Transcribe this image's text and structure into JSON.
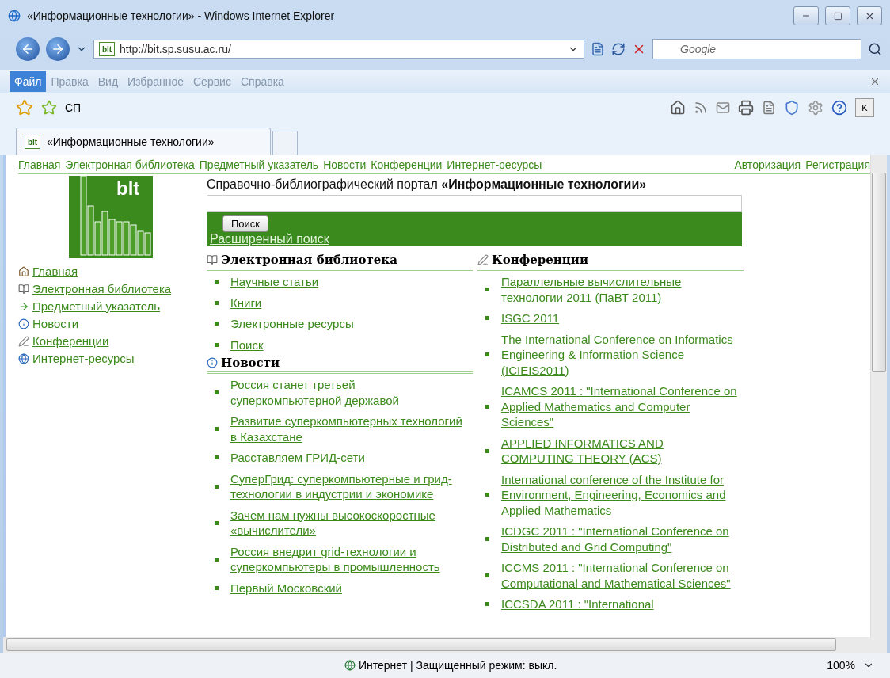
{
  "window": {
    "title": "«Информационные технологии» - Windows Internet Explorer"
  },
  "address_bar": {
    "favicon_text": "blt",
    "url": "http://bit.sp.susu.ac.ru/",
    "search_placeholder": "Google"
  },
  "menu": [
    {
      "label": "Файл",
      "selected": true
    },
    {
      "label": "Правка",
      "selected": false
    },
    {
      "label": "Вид",
      "selected": false
    },
    {
      "label": "Избранное",
      "selected": false
    },
    {
      "label": "Сервис",
      "selected": false
    },
    {
      "label": "Справка",
      "selected": false
    }
  ],
  "favorites_bar": {
    "label": "СП",
    "key_label": "K"
  },
  "tabs": [
    {
      "favicon_text": "blt",
      "label": "«Информационные технологии»",
      "selected": true
    }
  ],
  "page": {
    "top_nav": [
      "Главная",
      "Электронная библиотека",
      "Предметный указатель",
      "Новости",
      "Конференции",
      "Интернет-ресурсы"
    ],
    "account_links": [
      "Авторизация",
      "Регистрация"
    ],
    "logo_text": "blt",
    "side_nav": [
      {
        "label": "Главная",
        "kind": "home"
      },
      {
        "label": "Электронная библиотека",
        "kind": "book"
      },
      {
        "label": "Предметный указатель",
        "kind": "arrow"
      },
      {
        "label": "Новости",
        "kind": "info"
      },
      {
        "label": "Конференции",
        "kind": "note"
      },
      {
        "label": "Интернет-ресурсы",
        "kind": "globe"
      }
    ],
    "portal_heading": "Справочно-библиографический портал **«Информационные технологии»**",
    "search": {
      "button": "Поиск",
      "advanced_link": "Расширенный поиск"
    },
    "sections": [
      {
        "title": "Электронная библиотека",
        "kind": "book",
        "links": [
          "Научные статьи",
          "Книги",
          "Электронные ресурсы",
          "Поиск"
        ]
      },
      {
        "title": "Новости",
        "kind": "info",
        "links": [
          "Россия станет третьей суперкомпьютерной державой",
          "Развитие суперкомпьютерных технологий в Казахстане",
          "Расставляем ГРИД-сети",
          "СуперГрид: суперкомпьютерные и грид-технологии в индустрии и экономике",
          "Зачем нам нужны высокоскоростные «вычислители»",
          "Россия внедрит grid-технологии и суперкомпьютеры в промышленность",
          "Первый Московский"
        ]
      },
      {
        "title": "Конференции",
        "kind": "note",
        "links": [
          "Параллельные вычислительные технологии 2011 (ПаВТ 2011)",
          "ISGC 2011",
          "The International Conference on Informatics Engineering & Information Science (ICIEIS2011)",
          "ICAMCS 2011 : \"International Conference on Applied Mathematics and Computer Sciences\"",
          "APPLIED INFORMATICS AND COMPUTING THEORY (ACS)",
          "International conference of the Institute for Environment, Engineering, Economics and Applied Mathematics",
          "ICDGC 2011 : \"International Conference on Distributed and Grid Computing\"",
          "ICCMS 2011 : \"International Conference on Computational and Mathematical Sciences\"",
          "ICCSDA 2011 : \"International"
        ]
      }
    ]
  },
  "status_bar": {
    "zone": "Интернет | Защищенный режим: выкл.",
    "zoom": "100%"
  }
}
